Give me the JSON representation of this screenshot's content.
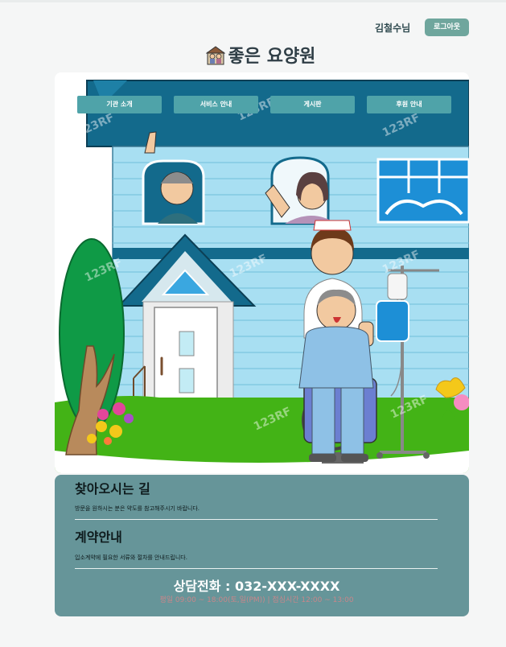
{
  "header": {
    "user_name": "김철수님",
    "logout_label": "로그아웃",
    "site_title": "좋은 요양원",
    "title_icon": "nursing-home-icon"
  },
  "nav": {
    "tabs": [
      {
        "label": "기관 소개"
      },
      {
        "label": "서비스 안내"
      },
      {
        "label": "게시판"
      },
      {
        "label": "후원 안내"
      }
    ]
  },
  "hero": {
    "image": "nursing-home-illustration",
    "watermark": "123RF"
  },
  "info": {
    "directions_title": "찾아오시는 길",
    "directions_desc": "방문을 원하시는 분은 약도를 참고해주시기 바랍니다.",
    "contract_title": "계약안내",
    "contract_desc": "입소계약에 필요한 서류와 절차를 안내드립니다.",
    "phone": "상담전화 : 032-XXX-XXXX",
    "hours": "평일 09:00 ~ 18:00(토,일(PM)) | 점심시간 12:00 ~ 13:00"
  },
  "colors": {
    "accent": "#6fa69d",
    "nav_tab": "#4fa3a9",
    "info_panel": "#669599"
  }
}
